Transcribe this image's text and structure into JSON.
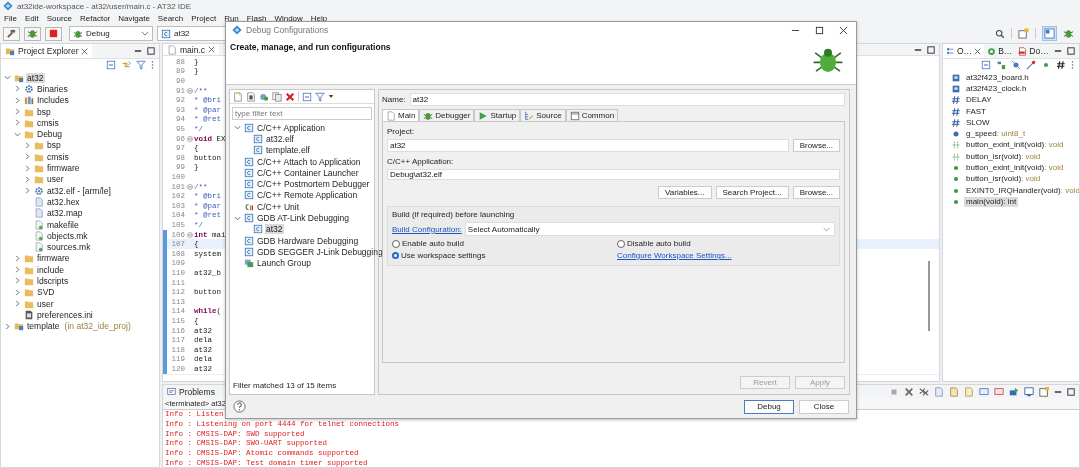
{
  "window": {
    "title": "at32ide-workspace - at32/user/main.c - AT32 IDE"
  },
  "menu": [
    "File",
    "Edit",
    "Source",
    "Refactor",
    "Navigate",
    "Search",
    "Project",
    "Run",
    "Flash",
    "Window",
    "Help"
  ],
  "toolbar": {
    "config_combo": "Debug",
    "target_combo": "at32"
  },
  "project_explorer": {
    "title": "Project Explorer",
    "tree": [
      {
        "label": "at32",
        "kind": "project",
        "expanded": true,
        "selected": true,
        "children": [
          {
            "label": "Binaries",
            "kind": "binaries",
            "expanded": false,
            "selected": false
          },
          {
            "label": "Includes",
            "kind": "includes",
            "expanded": false,
            "selected": false
          },
          {
            "label": "bsp",
            "kind": "folder",
            "expanded": false,
            "selected": false
          },
          {
            "label": "cmsis",
            "kind": "folder",
            "expanded": false,
            "selected": false
          },
          {
            "label": "Debug",
            "kind": "folder",
            "expanded": true,
            "selected": false,
            "children": [
              {
                "label": "bsp",
                "kind": "folder",
                "expanded": false,
                "selected": false
              },
              {
                "label": "cmsis",
                "kind": "folder",
                "expanded": false,
                "selected": false
              },
              {
                "label": "firmware",
                "kind": "folder",
                "expanded": false,
                "selected": false
              },
              {
                "label": "user",
                "kind": "folder",
                "expanded": false,
                "selected": false
              },
              {
                "label": "at32.elf - [arm/le]",
                "kind": "elf",
                "expanded": false,
                "selected": false
              },
              {
                "label": "at32.hex",
                "kind": "file",
                "selected": false
              },
              {
                "label": "at32.map",
                "kind": "file",
                "selected": false
              },
              {
                "label": "makefile",
                "kind": "makefile",
                "selected": false
              },
              {
                "label": "objects.mk",
                "kind": "makefile",
                "selected": false
              },
              {
                "label": "sources.mk",
                "kind": "makefile",
                "selected": false
              }
            ]
          },
          {
            "label": "firmware",
            "kind": "folder",
            "expanded": false,
            "selected": false
          },
          {
            "label": "include",
            "kind": "folder",
            "expanded": false,
            "selected": false
          },
          {
            "label": "ldscripts",
            "kind": "folder",
            "expanded": false,
            "selected": false
          },
          {
            "label": "SVD",
            "kind": "folder",
            "expanded": false,
            "selected": false
          },
          {
            "label": "user",
            "kind": "folder",
            "expanded": false,
            "selected": false
          },
          {
            "label": "preferences.ini",
            "kind": "ini",
            "selected": false
          }
        ]
      },
      {
        "label": "template",
        "note": "(in at32_ide_proj)",
        "kind": "project",
        "expanded": false,
        "selected": false
      }
    ]
  },
  "editor": {
    "tab": "main.c",
    "lines": [
      {
        "n": "88",
        "code": "  }",
        "kind": "plain",
        "fold": false,
        "marked": false,
        "current": false
      },
      {
        "n": "89",
        "code": "}",
        "kind": "plain",
        "fold": false,
        "marked": false,
        "current": false
      },
      {
        "n": "90",
        "fold": false,
        "marked": false,
        "current": false
      },
      {
        "n": "91",
        "code": "/**",
        "kind": "comment",
        "fold": true,
        "marked": false,
        "current": false
      },
      {
        "n": "92",
        "code": "  * @bri",
        "kind": "comment",
        "fold": false,
        "marked": false,
        "current": false
      },
      {
        "n": "93",
        "code": "  * @par",
        "kind": "comment",
        "fold": false,
        "marked": false,
        "current": false
      },
      {
        "n": "94",
        "code": "  * @ret",
        "kind": "comment",
        "fold": false,
        "marked": false,
        "current": false
      },
      {
        "n": "95",
        "code": "  */",
        "kind": "comment",
        "fold": false,
        "marked": false,
        "current": false
      },
      {
        "n": "96",
        "kw": "void",
        "code": " EX",
        "kind": "plain",
        "fold": true,
        "marked": false,
        "current": false
      },
      {
        "n": "97",
        "code": "{",
        "kind": "plain",
        "fold": false,
        "marked": false,
        "current": false
      },
      {
        "n": "98",
        "code": "  button",
        "kind": "plain",
        "fold": false,
        "marked": false,
        "current": false
      },
      {
        "n": "99",
        "code": "}",
        "kind": "plain",
        "fold": false,
        "marked": false,
        "current": false
      },
      {
        "n": "100",
        "fold": false,
        "marked": false,
        "current": false
      },
      {
        "n": "101",
        "code": "/**",
        "kind": "comment",
        "fold": true,
        "marked": false,
        "current": false
      },
      {
        "n": "102",
        "code": "  * @bri",
        "kind": "comment",
        "fold": false,
        "marked": false,
        "current": false
      },
      {
        "n": "103",
        "code": "  * @par",
        "kind": "comment",
        "fold": false,
        "marked": false,
        "current": false
      },
      {
        "n": "104",
        "code": "  * @ret",
        "kind": "comment",
        "fold": false,
        "marked": false,
        "current": false
      },
      {
        "n": "105",
        "code": "  */",
        "kind": "comment",
        "fold": false,
        "marked": false,
        "current": false
      },
      {
        "n": "106",
        "kw": "int",
        "code": " mai",
        "kind": "plain",
        "fold": true,
        "marked": true,
        "current": false
      },
      {
        "n": "107",
        "code": "{",
        "kind": "plain",
        "fold": false,
        "marked": true,
        "current": true
      },
      {
        "n": "108",
        "code": "  system",
        "kind": "plain",
        "fold": false,
        "marked": true,
        "current": false
      },
      {
        "n": "109",
        "fold": false,
        "marked": true,
        "current": false
      },
      {
        "n": "110",
        "code": "  at32_b",
        "kind": "plain",
        "fold": false,
        "marked": true,
        "current": false
      },
      {
        "n": "111",
        "fold": false,
        "marked": true,
        "current": false
      },
      {
        "n": "112",
        "code": "  button",
        "kind": "plain",
        "fold": false,
        "marked": true,
        "current": false
      },
      {
        "n": "113",
        "fold": false,
        "marked": true,
        "current": false
      },
      {
        "n": "114",
        "kw": "  while",
        "code": "(",
        "kind": "plain",
        "fold": false,
        "marked": true,
        "current": false
      },
      {
        "n": "115",
        "code": "  {",
        "kind": "plain",
        "fold": false,
        "marked": true,
        "current": false
      },
      {
        "n": "116",
        "code": "    at32",
        "kind": "plain",
        "fold": false,
        "marked": true,
        "current": false
      },
      {
        "n": "117",
        "code": "    dela",
        "kind": "plain",
        "fold": false,
        "marked": true,
        "current": false
      },
      {
        "n": "118",
        "code": "    at32",
        "kind": "plain",
        "fold": false,
        "marked": true,
        "current": false
      },
      {
        "n": "119",
        "code": "    dela",
        "kind": "plain",
        "fold": false,
        "marked": true,
        "current": false
      },
      {
        "n": "120",
        "code": "    at32",
        "kind": "plain",
        "fold": false,
        "marked": true,
        "current": false
      }
    ]
  },
  "outline": {
    "tabs": [
      {
        "label": "O…",
        "selected": true
      },
      {
        "label": "B…",
        "selected": false
      },
      {
        "label": "Do…",
        "selected": false
      }
    ],
    "items": [
      {
        "name": "at32f423_board.h",
        "kind": "include",
        "selected": false
      },
      {
        "name": "at32f423_clock.h",
        "kind": "include",
        "selected": false
      },
      {
        "name": "DELAY",
        "kind": "macro",
        "selected": false
      },
      {
        "name": "FAST",
        "kind": "macro",
        "selected": false
      },
      {
        "name": "SLOW",
        "kind": "macro",
        "selected": false
      },
      {
        "name": "g_speed",
        "type": ": uint8_t",
        "kind": "variable",
        "selected": false
      },
      {
        "name": "button_exint_init(void)",
        "type": ": void",
        "kind": "declaration",
        "selected": false
      },
      {
        "name": "button_isr(void)",
        "type": ": void",
        "kind": "declaration",
        "selected": false
      },
      {
        "name": "button_exint_init(void)",
        "type": ": void",
        "kind": "function",
        "selected": false
      },
      {
        "name": "button_isr(void)",
        "type": ": void",
        "kind": "function",
        "selected": false
      },
      {
        "name": "EXINT0_IRQHandler(void)",
        "type": ": void",
        "kind": "function",
        "selected": false
      },
      {
        "name": "main(void)",
        "type": ": int",
        "kind": "function",
        "selected": true
      }
    ]
  },
  "console": {
    "tabs": [
      {
        "label": "Problems",
        "selected": false
      }
    ],
    "status": "<terminated> at32",
    "lines": [
      "Info : Listen",
      "Info : Listening on port 4444 for telnet connections",
      "Info : CMSIS-DAP: SWD supported",
      "Info : CMSIS-DAP: SWO-UART supported",
      "Info : CMSIS-DAP: Atomic commands supported",
      "Info : CMSIS-DAP: Test domain timer supported"
    ]
  },
  "dialog": {
    "title": "Debug Configurations",
    "heading": "Create, manage, and run configurations",
    "filter": {
      "placeholder": "type filter text"
    },
    "tree": [
      {
        "label": "C/C++ Application",
        "kind": "config",
        "expanded": true,
        "selected": false,
        "children": [
          {
            "label": "at32.elf",
            "kind": "config",
            "selected": false
          },
          {
            "label": "template.elf",
            "kind": "config",
            "selected": false
          }
        ]
      },
      {
        "label": "C/C++ Attach to Application",
        "kind": "config",
        "selected": false
      },
      {
        "label": "C/C++ Container Launcher",
        "kind": "config",
        "selected": false
      },
      {
        "label": "C/C++ Postmortem Debugger",
        "kind": "config",
        "selected": false
      },
      {
        "label": "C/C++ Remote Application",
        "kind": "config",
        "selected": false
      },
      {
        "label": "C/C++ Unit",
        "kind": "cunit",
        "selected": false
      },
      {
        "label": "GDB AT-Link Debugging",
        "kind": "config",
        "expanded": true,
        "selected": false,
        "children": [
          {
            "label": "at32",
            "kind": "config",
            "selected": true
          }
        ]
      },
      {
        "label": "GDB Hardware Debugging",
        "kind": "config",
        "selected": false
      },
      {
        "label": "GDB SEGGER J-Link Debugging",
        "kind": "config",
        "selected": false
      },
      {
        "label": "Launch Group",
        "kind": "group",
        "selected": false
      }
    ],
    "filter_status": "Filter matched 13 of 15 items",
    "name_label": "Name:",
    "name": "at32",
    "tabs": [
      {
        "label": "Main",
        "kind": "page",
        "selected": true
      },
      {
        "label": "Debugger",
        "kind": "bug",
        "selected": false
      },
      {
        "label": "Startup",
        "kind": "play",
        "selected": false
      },
      {
        "label": "Source",
        "kind": "source",
        "selected": false
      },
      {
        "label": "Common",
        "kind": "window",
        "selected": false
      }
    ],
    "project_label": "Project:",
    "project": "at32",
    "project_browse": "Browse...",
    "app_label": "C/C++ Application:",
    "app": "Debug\\at32.elf",
    "app_buttons": [
      "Variables...",
      "Search Project...",
      "Browse..."
    ],
    "build": {
      "legend": "Build (if required) before launching",
      "config_link": "Build Configuration:",
      "config_value": "Select Automatically",
      "radios": [
        {
          "label": "Enable auto build",
          "selected": false
        },
        {
          "label": "Use workspace settings",
          "selected": true
        },
        {
          "label": "Disable auto build",
          "selected": false
        }
      ],
      "workspace_link": "Configure Workspace Settings..."
    },
    "revert": {
      "label": "Revert",
      "disabled": true
    },
    "apply": {
      "label": "Apply",
      "disabled": true
    },
    "footer_buttons": [
      {
        "label": "Debug",
        "default": true
      },
      {
        "label": "Close",
        "default": false
      }
    ]
  }
}
